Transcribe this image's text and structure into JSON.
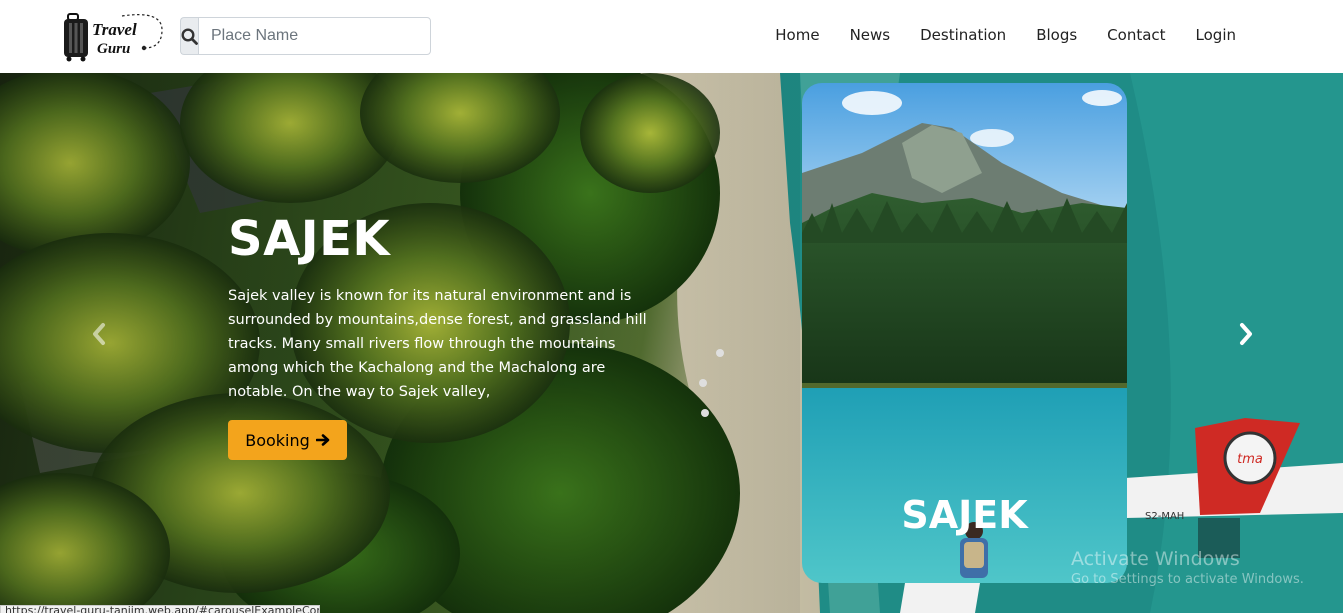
{
  "brand": {
    "line1": "Travel",
    "line2": "Guru"
  },
  "search": {
    "placeholder": "Place Name"
  },
  "nav": {
    "items": [
      "Home",
      "News",
      "Destination",
      "Blogs",
      "Contact",
      "Login"
    ]
  },
  "hero": {
    "title": "SAJEK",
    "description": "Sajek valley is known for its natural environment and is surrounded by mountains,dense forest, and grassland hill tracks. Many small rivers flow through the mountains among which the Kachalong and the Machalong are notable. On the way to Sajek valley,",
    "booking_label": "Booking",
    "plane_text": "S2-MAH",
    "plane_logo": "tma"
  },
  "card": {
    "title": "SAJEK"
  },
  "watermark": {
    "line1": "Activate Windows",
    "line2": "Go to Settings to activate Windows."
  },
  "status_bar": {
    "url": "https://travel-guru-tanjim.web.app/#carouselExampleControls"
  },
  "colors": {
    "accent": "#f3a41c",
    "nav_text": "#222222",
    "search_addon": "#e9ecef"
  }
}
